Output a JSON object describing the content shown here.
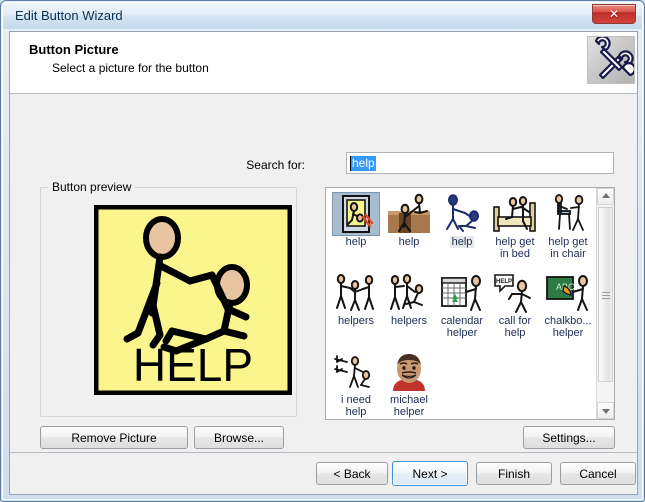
{
  "window": {
    "title": "Edit Button Wizard",
    "close_label": "✕"
  },
  "header": {
    "title": "Button Picture",
    "subtitle": "Select a picture for the button",
    "icon": "tools-icon"
  },
  "search": {
    "label": "Search for:",
    "value": "help",
    "placeholder": ""
  },
  "preview": {
    "legend": "Button preview",
    "symbol_caption": "HELP",
    "symbol_bg": "#faf58c",
    "symbol_border": "#000000",
    "skin_color": "#e8c4a0"
  },
  "grid": {
    "items": [
      {
        "label": "help",
        "art": "help-framed-picture-icon",
        "selected": true,
        "label_highlight": false
      },
      {
        "label": "help",
        "art": "help-out-of-hole-icon",
        "selected": false,
        "label_highlight": false
      },
      {
        "label": "help",
        "art": "help-lift-up-icon",
        "selected": false,
        "label_highlight": true
      },
      {
        "label": "help get in bed",
        "art": "help-get-in-bed-icon",
        "selected": false,
        "label_highlight": false
      },
      {
        "label": "help get in chair",
        "art": "help-get-in-chair-icon",
        "selected": false,
        "label_highlight": false
      },
      {
        "label": "helpers",
        "art": "helpers-three-icon",
        "selected": false,
        "label_highlight": false
      },
      {
        "label": "helpers",
        "art": "helpers-group-icon",
        "selected": false,
        "label_highlight": false
      },
      {
        "label": "calendar helper",
        "art": "calendar-helper-icon",
        "selected": false,
        "label_highlight": false
      },
      {
        "label": "call for help",
        "art": "call-for-help-icon",
        "selected": false,
        "label_highlight": false
      },
      {
        "label": "chalkbo... helper",
        "art": "chalkboard-helper-icon",
        "selected": false,
        "label_highlight": false
      },
      {
        "label": "i need help",
        "art": "i-need-help-icon",
        "selected": false,
        "label_highlight": false
      },
      {
        "label": "michael helper",
        "art": "michael-photo-icon",
        "selected": false,
        "label_highlight": false
      }
    ],
    "columns": 5
  },
  "scrollbar": {
    "up_arrow": "scroll-up-arrow",
    "down_arrow": "scroll-down-arrow"
  },
  "actions": {
    "remove_picture": "Remove Picture",
    "browse": "Browse...",
    "settings": "Settings..."
  },
  "footer": {
    "back": "< Back",
    "next": "Next >",
    "finish": "Finish",
    "cancel": "Cancel",
    "focused": "next"
  },
  "colors": {
    "selection_blue": "#3399ff",
    "title_text": "#0c2f4f",
    "label_text": "#1b2c54",
    "close_red": "#c0392b"
  }
}
